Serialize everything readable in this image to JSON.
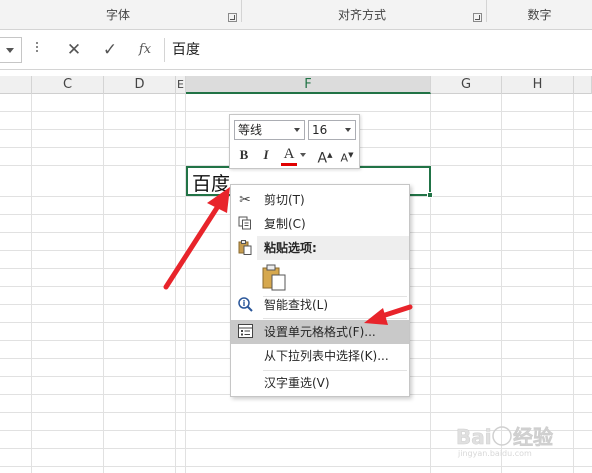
{
  "ribbon": {
    "groups": [
      "字体",
      "对齐方式",
      "数字"
    ]
  },
  "formula_bar": {
    "cancel_icon": "✕",
    "enter_icon": "✓",
    "fx_label": "fx",
    "content": "百度"
  },
  "columns": [
    "C",
    "D",
    "E",
    "F",
    "G",
    "H"
  ],
  "active_cell": {
    "column": "F",
    "text": "百度"
  },
  "mini_toolbar": {
    "font_name": "等线",
    "font_size": "16",
    "bold": "B",
    "italic": "I",
    "font_color": "A",
    "grow_font": "A",
    "shrink_font": "A",
    "font_color_bar": "#e00000"
  },
  "context_menu": {
    "items": [
      {
        "label": "剪切(T)",
        "icon": "scissors-icon"
      },
      {
        "label": "复制(C)",
        "icon": "copy-icon"
      },
      {
        "label": "粘贴选项:",
        "icon": "paste-icon"
      },
      {
        "label": "智能查找(L)",
        "icon": "smart-lookup-icon"
      },
      {
        "label": "设置单元格格式(F)...",
        "icon": "format-cells-icon"
      },
      {
        "label": "从下拉列表中选择(K)...",
        "icon": ""
      },
      {
        "label": "汉字重选(V)",
        "icon": ""
      }
    ]
  },
  "colors": {
    "excel_green": "#217346",
    "arrow_red": "#e8242b",
    "highlight": "#c9c9c9"
  },
  "watermark": "Baidu 经验"
}
